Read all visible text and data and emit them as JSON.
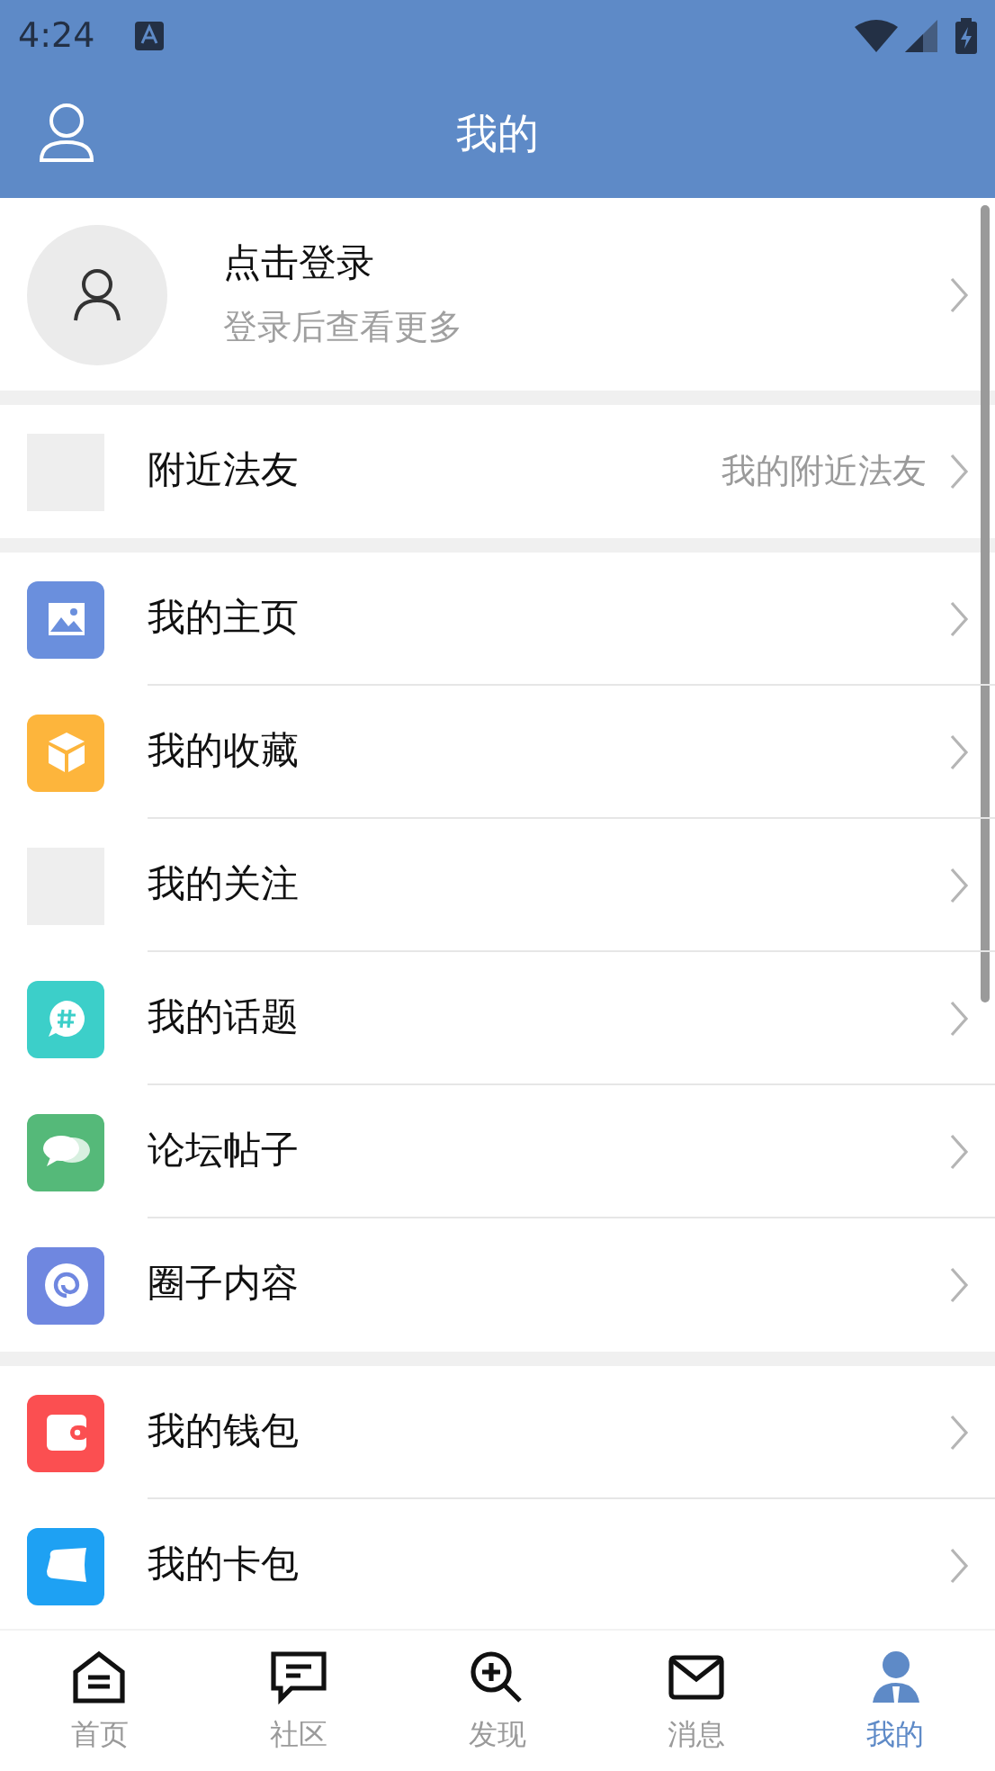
{
  "status_bar": {
    "time": "4:24"
  },
  "header": {
    "title": "我的"
  },
  "profile": {
    "title": "点击登录",
    "subtitle": "登录后查看更多"
  },
  "sections": [
    [
      {
        "label": "附近法友",
        "detail": "我的附近法友",
        "kind": "blank",
        "color": "#eeeeee"
      }
    ],
    [
      {
        "label": "我的主页",
        "kind": "image",
        "color": "#6a8fdd"
      },
      {
        "label": "我的收藏",
        "kind": "box",
        "color": "#fdb53c"
      },
      {
        "label": "我的关注",
        "kind": "blank",
        "color": "#eeeeee"
      },
      {
        "label": "我的话题",
        "kind": "topic",
        "color": "#3ccfc9"
      },
      {
        "label": "论坛帖子",
        "kind": "chat",
        "color": "#55b979"
      },
      {
        "label": "圈子内容",
        "kind": "swirl",
        "color": "#6f87e0"
      }
    ],
    [
      {
        "label": "我的钱包",
        "kind": "wallet",
        "color": "#fb4f51"
      },
      {
        "label": "我的卡包",
        "kind": "card",
        "color": "#1ea1f3"
      }
    ]
  ],
  "tabs": [
    {
      "label": "首页",
      "kind": "home",
      "selected": false
    },
    {
      "label": "社区",
      "kind": "chat",
      "selected": false
    },
    {
      "label": "发现",
      "kind": "zoom",
      "selected": false
    },
    {
      "label": "消息",
      "kind": "mail",
      "selected": false
    },
    {
      "label": "我的",
      "kind": "person",
      "selected": true
    }
  ]
}
